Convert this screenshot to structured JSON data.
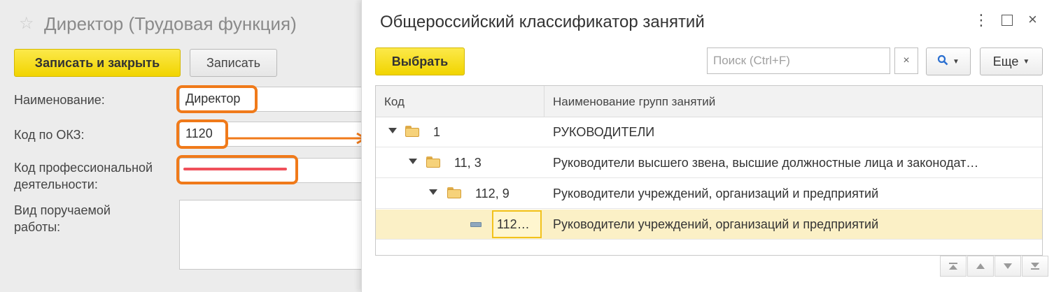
{
  "form": {
    "title": "Директор (Трудовая функция)",
    "buttons": {
      "save_close": "Записать и закрыть",
      "save": "Записать"
    },
    "fields": {
      "name_label": "Наименование:",
      "name_value": "Директор",
      "okz_label": "Код по ОКЗ:",
      "okz_value": "1120",
      "prof_label_line1": "Код профессиональной",
      "prof_label_line2": "деятельности:",
      "work_label_line1": "Вид поручаемой",
      "work_label_line2": "работы:"
    }
  },
  "dialog": {
    "title": "Общероссийский классификатор занятий",
    "select_button": "Выбрать",
    "search": {
      "placeholder": "Поиск (Ctrl+F)",
      "clear": "×"
    },
    "more_button": "Еще",
    "table": {
      "columns": [
        "Код",
        "Наименование групп занятий"
      ],
      "rows": [
        {
          "code": "1",
          "name": "РУКОВОДИТЕЛИ",
          "level": 0,
          "kind": "folder"
        },
        {
          "code": "11, 3",
          "name": "Руководители высшего звена, высшие должностные лица и законодат…",
          "level": 1,
          "kind": "folder"
        },
        {
          "code": "112, 9",
          "name": "Руководители учреждений, организаций и предприятий",
          "level": 2,
          "kind": "folder"
        },
        {
          "code": "112…",
          "name": "Руководители учреждений, организаций и предприятий",
          "level": 3,
          "kind": "item",
          "selected": true
        }
      ]
    }
  },
  "colors": {
    "accent_yellow": "#f1d400",
    "highlight_orange": "#f07a1a",
    "selection_row": "#fbf0c6",
    "strike_red": "#f0505a"
  },
  "icons": [
    "star-icon",
    "more-vert-icon",
    "maximize-icon",
    "close-icon",
    "search-icon",
    "folder-icon",
    "leaf-item-icon",
    "expand-triangle-icon"
  ]
}
